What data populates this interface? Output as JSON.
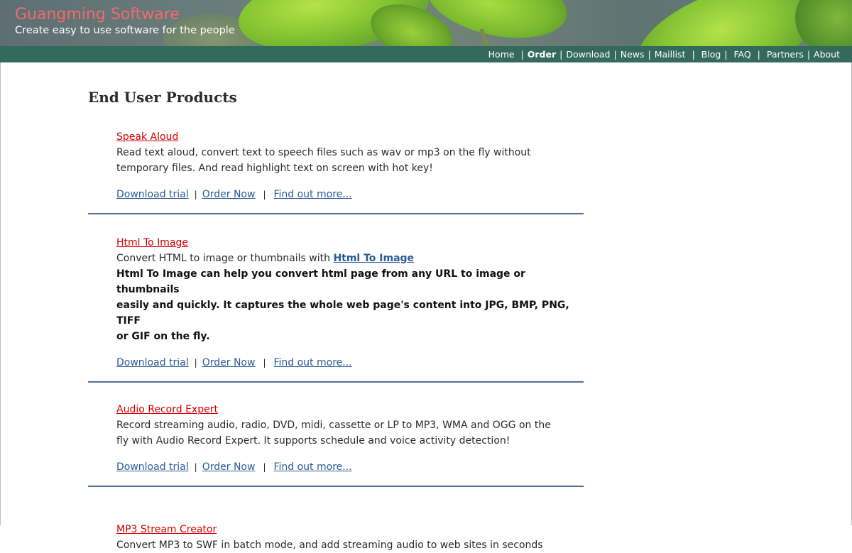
{
  "header": {
    "site_title": "Guangming Software",
    "tagline": "Create easy to use software for the people"
  },
  "nav": {
    "items": [
      {
        "label": "Home",
        "active": false
      },
      {
        "label": "Order",
        "active": true
      },
      {
        "label": "Download",
        "active": false
      },
      {
        "label": "News",
        "active": false
      },
      {
        "label": "Maillist",
        "active": false
      },
      {
        "label": "Blog",
        "active": false
      },
      {
        "label": "FAQ",
        "active": false
      },
      {
        "label": "Partners",
        "active": false
      },
      {
        "label": "About",
        "active": false
      }
    ]
  },
  "main": {
    "heading": "End User Products",
    "link_labels": {
      "download": "Download trial",
      "order": "Order Now",
      "more": "Find out more...",
      "separator": "|"
    },
    "products": [
      {
        "title": "Speak Aloud",
        "desc_line1": "Read text aloud, convert text to speech files such as wav or mp3 on the fly without",
        "desc_line2": "temporary files. And read highlight text on screen with hot key!"
      },
      {
        "title": "Html To Image",
        "desc_prefix": "Convert HTML to image or thumbnails with ",
        "desc_link": "Html To Image",
        "desc_bold_line1": "Html To Image can help you convert html page from any URL to image or thumbnails",
        "desc_bold_line2": "easily and quickly. It captures the whole web page's content into JPG, BMP, PNG, TIFF",
        "desc_bold_line3": "or GIF on the fly."
      },
      {
        "title": "Audio Record Expert",
        "desc_line1": "Record streaming audio, radio, DVD, midi, cassette or LP to MP3, WMA and OGG on the",
        "desc_line2": "fly with Audio Record Expert. It supports schedule and voice activity detection!"
      },
      {
        "title": "MP3 Stream Creator",
        "desc_line1": "Convert MP3 to SWF in batch mode, and add streaming audio to web sites in seconds"
      }
    ]
  },
  "colors": {
    "navbar_bg": "#336a5c",
    "title_red": "#d40000",
    "link_blue": "#2a5a96",
    "divider": "#4f6f9a"
  }
}
